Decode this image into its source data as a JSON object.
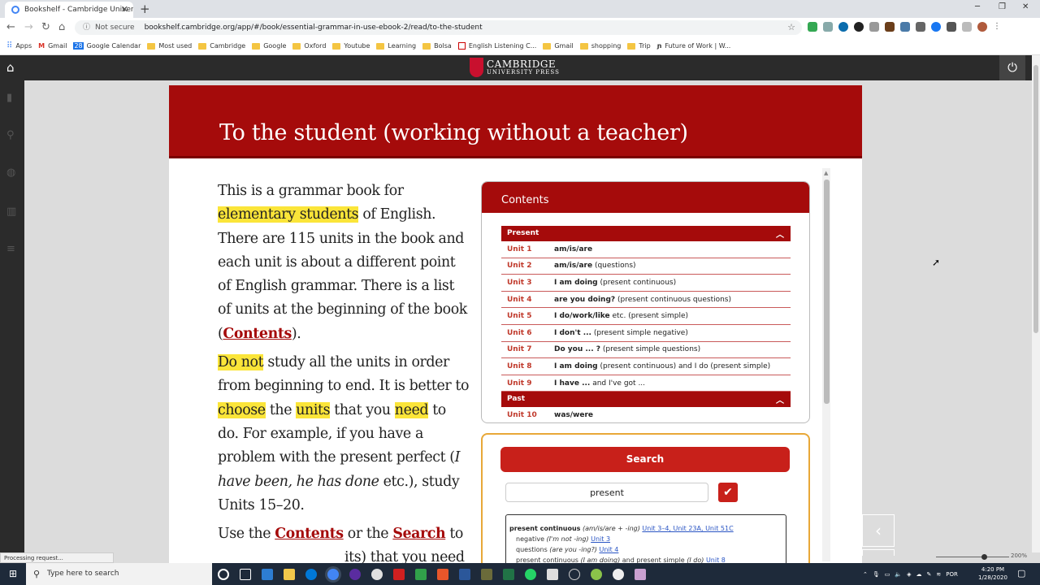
{
  "browser": {
    "tab_title": "Bookshelf - Cambridge Universit",
    "new_tab": "+",
    "url_status": "Not secure",
    "url": "bookshelf.cambridge.org/app/#/book/essential-grammar-in-use-ebook-2/read/to-the-student",
    "bookmarks": [
      "Apps",
      "Gmail",
      "Google Calendar",
      "Most used",
      "Cambridge",
      "Google",
      "Oxford",
      "Youtube",
      "Learning",
      "Bolsa",
      "English Listening C...",
      "Gmail",
      "shopping",
      "Trip",
      "Future of Work | W..."
    ]
  },
  "app": {
    "logo_line1": "CAMBRIDGE",
    "logo_line2": "UNIVERSITY PRESS"
  },
  "page": {
    "title": "To the student  (working without a teacher)",
    "p1_a": "This is a grammar book for ",
    "p1_hl": "elementary students",
    "p1_b": " of English. There are 115 units in the book and each unit is about a different point of English grammar. There is a list of units at the beginning of the book (",
    "p1_link": "Contents",
    "p1_c": ").",
    "p2_hl1": "Do not",
    "p2_a": " study all the units in order from beginning to end. It is better to ",
    "p2_hl2": "choose",
    "p2_b": " the ",
    "p2_hl3": "units",
    "p2_c": " that you ",
    "p2_hl4": "need",
    "p2_d": " to do. For example, if you have a problem with the present perfect (",
    "p2_it": "I have been, he has done",
    "p2_e": " etc.), study Units 15–20.",
    "p3_a": "Use the ",
    "p3_link1": "Contents",
    "p3_b": " or the ",
    "p3_link2": "Search",
    "p3_c": " to",
    "p3_d": "its) that you need"
  },
  "contents_panel": {
    "header": "Contents",
    "section_present": "Present",
    "units": [
      {
        "unit": "Unit 1",
        "bold": "am/is/are",
        "rest": ""
      },
      {
        "unit": "Unit 2",
        "bold": "am/is/are",
        "rest": "  (questions)"
      },
      {
        "unit": "Unit 3",
        "bold": "I am doing",
        "rest": "  (present continuous)"
      },
      {
        "unit": "Unit 4",
        "bold": "are you doing?",
        "rest": "  (present continuous questions)"
      },
      {
        "unit": "Unit 5",
        "bold": "I do/work/like",
        "rest": " etc.  (present simple)"
      },
      {
        "unit": "Unit 6",
        "bold": "I don't ...",
        "rest": "  (present simple negative)"
      },
      {
        "unit": "Unit 7",
        "bold": "Do you ... ?",
        "rest": "  (present simple questions)"
      },
      {
        "unit": "Unit 8",
        "bold": "I am doing",
        "rest": " (present continuous) and I do (present simple)"
      },
      {
        "unit": "Unit 9",
        "bold": "I have ...",
        "rest": "  and  I've got ..."
      }
    ],
    "section_past": "Past",
    "past_units": [
      {
        "unit": "Unit 10",
        "bold": "was/were",
        "rest": ""
      }
    ]
  },
  "search_panel": {
    "button": "Search",
    "query": "present",
    "result1_bold": "present continuous",
    "result1_it": " (am/is/are + -ing) ",
    "result1_links": "Unit 3–4, Unit 23A, Unit 51C",
    "result2_a": "negative ",
    "result2_it": "(I'm not -ing) ",
    "result2_link": "Unit 3",
    "result3_a": "questions ",
    "result3_it": "(are you -ing?) ",
    "result3_link": "Unit 4",
    "result4_a": "present continuous ",
    "result4_it": "(I am doing)",
    "result4_b": " and present simple ",
    "result4_it2": "(I do) ",
    "result4_link": "Unit 8"
  },
  "status": {
    "loading": "Processing request...",
    "zoom": "200%"
  },
  "taskbar": {
    "search_placeholder": "Type here to search",
    "lang": "POR",
    "time": "4:20 PM",
    "date": "1/28/2020"
  }
}
